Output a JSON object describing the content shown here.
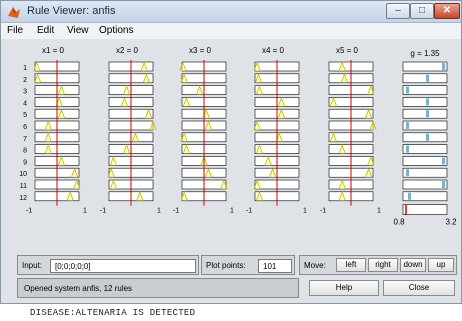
{
  "window": {
    "title": "Rule Viewer: anfis",
    "buttons": {
      "minimize": "–",
      "maximize": "□",
      "close": "✕"
    },
    "icon": "matlab-logo-icon"
  },
  "menu": [
    "File",
    "Edit",
    "View",
    "Options"
  ],
  "inputs": [
    {
      "label": "x1 = 0",
      "range_min": "-1",
      "range_max": "1"
    },
    {
      "label": "x2 = 0",
      "range_min": "-1",
      "range_max": "1"
    },
    {
      "label": "x3 = 0",
      "range_min": "-1",
      "range_max": "1"
    },
    {
      "label": "x4 = 0",
      "range_min": "-1",
      "range_max": "1"
    },
    {
      "label": "x5 = 0",
      "range_min": "-1",
      "range_max": "1"
    }
  ],
  "output": {
    "label": "g = 1.35",
    "range_min": "0.8",
    "range_max": "3.2"
  },
  "rule_numbers": [
    "1",
    "2",
    "3",
    "4",
    "5",
    "6",
    "7",
    "8",
    "9",
    "10",
    "11",
    "12"
  ],
  "bottom": {
    "input_label": "Input:",
    "input_value": "[0;0;0;0;0]",
    "plot_points_label": "Plot points:",
    "plot_points_value": "101",
    "move_label": "Move:",
    "move_buttons": [
      "left",
      "right",
      "down",
      "up"
    ],
    "status": "Opened system anfis, 12 rules",
    "help": "Help",
    "close": "Close"
  },
  "caption": "DISEASE:ALTENARIA  IS DETECTED",
  "colors": {
    "membership_line": "#c6b500",
    "membership_fill": "#ffff60",
    "input_marker": "#d10000",
    "output_fill": "#78b4c8",
    "panel": "#dfe3e8"
  }
}
